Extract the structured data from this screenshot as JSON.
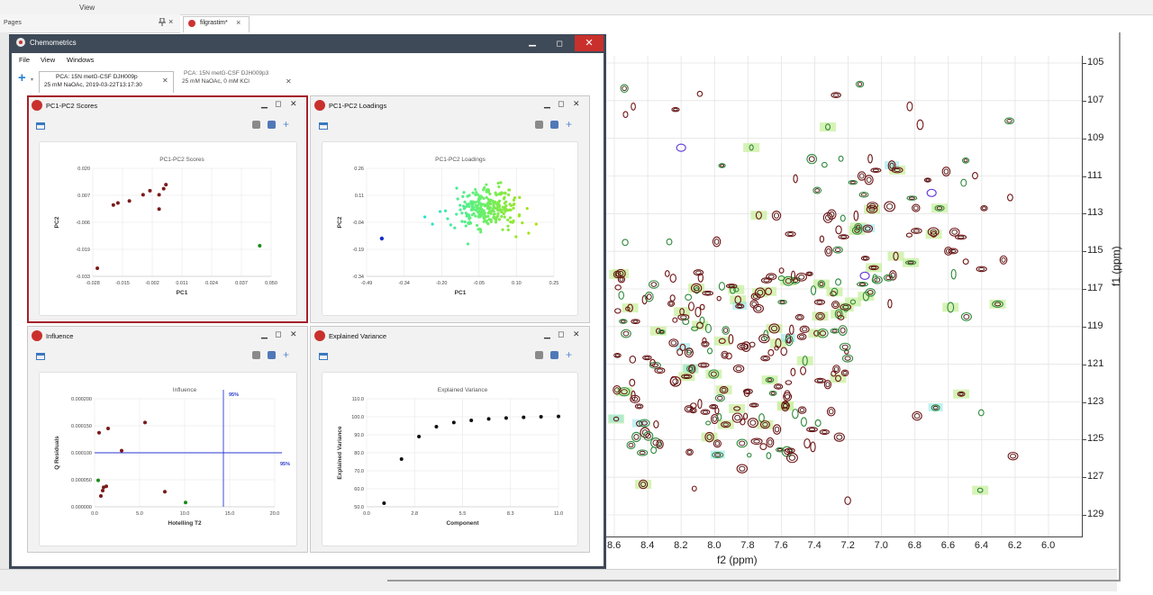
{
  "app": {
    "menu_view": "View",
    "pages_label": "Pages",
    "document_tab": "filgrastim*"
  },
  "chem_window": {
    "title": "Chemometrics",
    "menu": [
      "File",
      "View",
      "Windows"
    ],
    "tabs": [
      {
        "line1": "PCA: 15N metG-CSF DJH009p",
        "line2": "25 mM NaOAc, 2019-03-22T13:17:30"
      },
      {
        "line1": "PCA: 15N metG-CSF DJH009p3",
        "line2": "25 mM NaOAc, 0 mM KCl"
      }
    ]
  },
  "panels": {
    "scores": {
      "title": "PC1-PC2 Scores"
    },
    "loadings": {
      "title": "PC1-PC2 Loadings"
    },
    "influence": {
      "title": "Influence"
    },
    "variance": {
      "title": "Explained Variance"
    }
  },
  "spectrum": {
    "xlabel": "f2 (ppm)",
    "ylabel": "f1 (ppm)",
    "xticks": [
      "8.6",
      "8.4",
      "8.2",
      "8.0",
      "7.8",
      "7.6",
      "7.4",
      "7.2",
      "7.0",
      "6.8",
      "6.6",
      "6.4",
      "6.2",
      "6.0"
    ],
    "yticks": [
      "105",
      "107",
      "109",
      "111",
      "113",
      "115",
      "117",
      "119",
      "121",
      "123",
      "125",
      "127",
      "129"
    ]
  },
  "chart_data": [
    {
      "type": "scatter",
      "title": "PC1-PC2 Scores",
      "xlabel": "PC1",
      "ylabel": "PC2",
      "xticks": [
        "-0.028",
        "-0.015",
        "-0.002",
        "0.011",
        "0.024",
        "0.037",
        "0.050"
      ],
      "yticks": [
        "0.020",
        "0.007",
        "-0.006",
        "-0.019",
        "-0.033"
      ],
      "xlim": [
        -0.028,
        0.05
      ],
      "ylim": [
        -0.033,
        0.02
      ],
      "points": [
        {
          "x": -0.026,
          "y": -0.029,
          "color": "#7a1b1b"
        },
        {
          "x": -0.019,
          "y": 0.002,
          "color": "#7a1b1b"
        },
        {
          "x": -0.017,
          "y": 0.003,
          "color": "#7a1b1b"
        },
        {
          "x": -0.012,
          "y": 0.004,
          "color": "#7a1b1b"
        },
        {
          "x": -0.006,
          "y": 0.007,
          "color": "#7a1b1b"
        },
        {
          "x": -0.003,
          "y": 0.009,
          "color": "#7a1b1b"
        },
        {
          "x": 0.001,
          "y": 0.007,
          "color": "#7a1b1b"
        },
        {
          "x": 0.003,
          "y": 0.01,
          "color": "#7a1b1b"
        },
        {
          "x": 0.004,
          "y": 0.012,
          "color": "#7a1b1b"
        },
        {
          "x": 0.001,
          "y": 0.0,
          "color": "#7a1b1b"
        },
        {
          "x": 0.045,
          "y": -0.018,
          "color": "#1a8a1a"
        }
      ]
    },
    {
      "type": "scatter",
      "title": "PC1-PC2 Loadings",
      "xlabel": "PC1",
      "ylabel": "PC2",
      "xticks": [
        "-0.49",
        "-0.34",
        "-0.20",
        "-0.05",
        "0.10",
        "0.25"
      ],
      "yticks": [
        "0.26",
        "0.11",
        "-0.04",
        "-0.19",
        "-0.34"
      ],
      "ylim": [
        -0.34,
        0.26
      ],
      "note_points": "dense cluster of ~250 points centered near (0.0, 0.04); isolated point near (-0.43, -0.13)"
    },
    {
      "type": "scatter",
      "title": "Influence",
      "xlabel": "Hotelling T2",
      "ylabel": "Q Residuals",
      "xticks": [
        "0.0",
        "5.0",
        "10.0",
        "15.0",
        "20.0"
      ],
      "yticks": [
        "0.000200",
        "0.000150",
        "0.000100",
        "0.000050",
        "0.000000"
      ],
      "xlim": [
        0,
        20
      ],
      "ylim": [
        0,
        0.0002
      ],
      "threshold_x": 14.3,
      "threshold_y": 0.0001,
      "threshold_label": "95%",
      "points": [
        {
          "x": 0.4,
          "y": 4.9e-05,
          "color": "#1a8a1a"
        },
        {
          "x": 0.5,
          "y": 0.000137,
          "color": "#7a1b1b"
        },
        {
          "x": 0.7,
          "y": 2e-05,
          "color": "#7a1b1b"
        },
        {
          "x": 0.9,
          "y": 3e-05,
          "color": "#7a1b1b"
        },
        {
          "x": 1.0,
          "y": 3.6e-05,
          "color": "#7a1b1b"
        },
        {
          "x": 1.3,
          "y": 3.8e-05,
          "color": "#7a1b1b"
        },
        {
          "x": 1.5,
          "y": 0.000145,
          "color": "#7a1b1b"
        },
        {
          "x": 3.0,
          "y": 0.000104,
          "color": "#7a1b1b"
        },
        {
          "x": 5.6,
          "y": 0.000156,
          "color": "#7a1b1b"
        },
        {
          "x": 7.8,
          "y": 2.8e-05,
          "color": "#7a1b1b"
        },
        {
          "x": 10.1,
          "y": 8e-06,
          "color": "#1a8a1a"
        }
      ]
    },
    {
      "type": "scatter",
      "title": "Explained Variance",
      "xlabel": "Component",
      "ylabel": "Explained Variance",
      "xticks": [
        "0.0",
        "2.8",
        "5.5",
        "8.3",
        "11.0"
      ],
      "yticks": [
        "110.0",
        "100.0",
        "90.0",
        "80.0",
        "70.0",
        "60.0",
        "50.0"
      ],
      "xlim": [
        0,
        11
      ],
      "ylim": [
        50,
        110
      ],
      "points": [
        {
          "x": 1,
          "y": 52.0
        },
        {
          "x": 2,
          "y": 76.5
        },
        {
          "x": 3,
          "y": 89.0
        },
        {
          "x": 4,
          "y": 94.5
        },
        {
          "x": 5,
          "y": 96.8
        },
        {
          "x": 6,
          "y": 98.0
        },
        {
          "x": 7,
          "y": 98.8
        },
        {
          "x": 8,
          "y": 99.3
        },
        {
          "x": 9,
          "y": 99.7
        },
        {
          "x": 10,
          "y": 100.0
        },
        {
          "x": 11,
          "y": 100.2
        }
      ]
    }
  ]
}
